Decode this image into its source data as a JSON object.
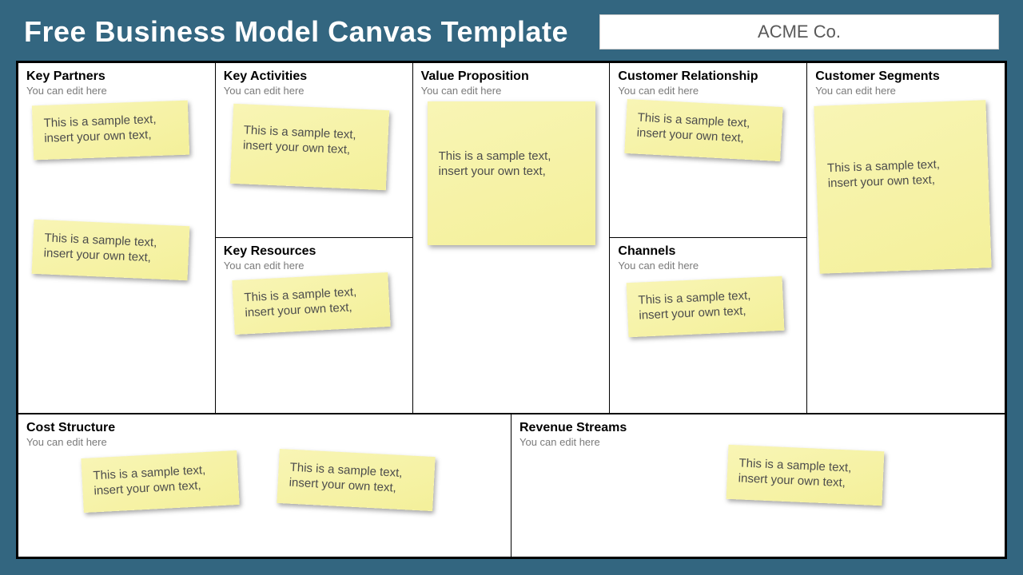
{
  "header": {
    "title": "Free Business Model Canvas Template",
    "company": "ACME Co."
  },
  "subtitle": "You can edit here",
  "note_line1": "This is a sample text,",
  "note_line2": "insert your own text,",
  "sections": {
    "kp": {
      "title": "Key Partners"
    },
    "ka": {
      "title": "Key Activities"
    },
    "kr": {
      "title": "Key Resources"
    },
    "vp": {
      "title": "Value Proposition"
    },
    "cr": {
      "title": "Customer Relationship"
    },
    "ch": {
      "title": "Channels"
    },
    "cs": {
      "title": "Customer Segments"
    },
    "cost": {
      "title": "Cost Structure"
    },
    "rev": {
      "title": "Revenue Streams"
    }
  }
}
